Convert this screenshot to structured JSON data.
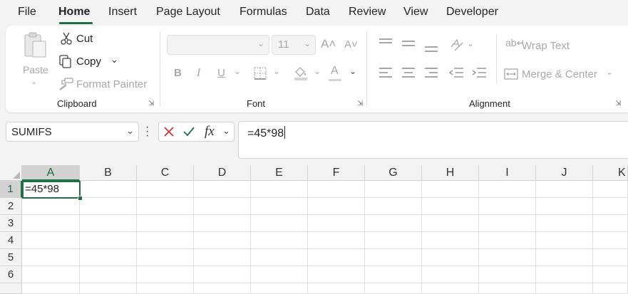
{
  "menu": {
    "items": [
      "File",
      "Home",
      "Insert",
      "Page Layout",
      "Formulas",
      "Data",
      "Review",
      "View",
      "Developer"
    ],
    "active": "Home"
  },
  "ribbon": {
    "clipboard": {
      "paste": "Paste",
      "cut": "Cut",
      "copy": "Copy",
      "format_painter": "Format Painter",
      "label": "Clipboard"
    },
    "font": {
      "font_name": "",
      "font_size": "11",
      "bold": "B",
      "italic": "I",
      "underline": "U",
      "font_color_letter": "A",
      "label": "Font"
    },
    "alignment": {
      "wrap_text": "Wrap Text",
      "merge_center": "Merge & Center",
      "label": "Alignment"
    }
  },
  "formula_bar": {
    "name_box": "SUMIFS",
    "fx": "fx",
    "formula": "=45*98"
  },
  "sheet": {
    "columns": [
      "A",
      "B",
      "C",
      "D",
      "E",
      "F",
      "G",
      "H",
      "I",
      "J",
      "K"
    ],
    "rows": [
      "1",
      "2",
      "3",
      "4",
      "5",
      "6"
    ],
    "active_cell": "A1",
    "cells": {
      "A1": "=45*98"
    }
  },
  "colors": {
    "accent": "#1e7145",
    "cancel": "#d13438",
    "confirm": "#1e7145"
  }
}
